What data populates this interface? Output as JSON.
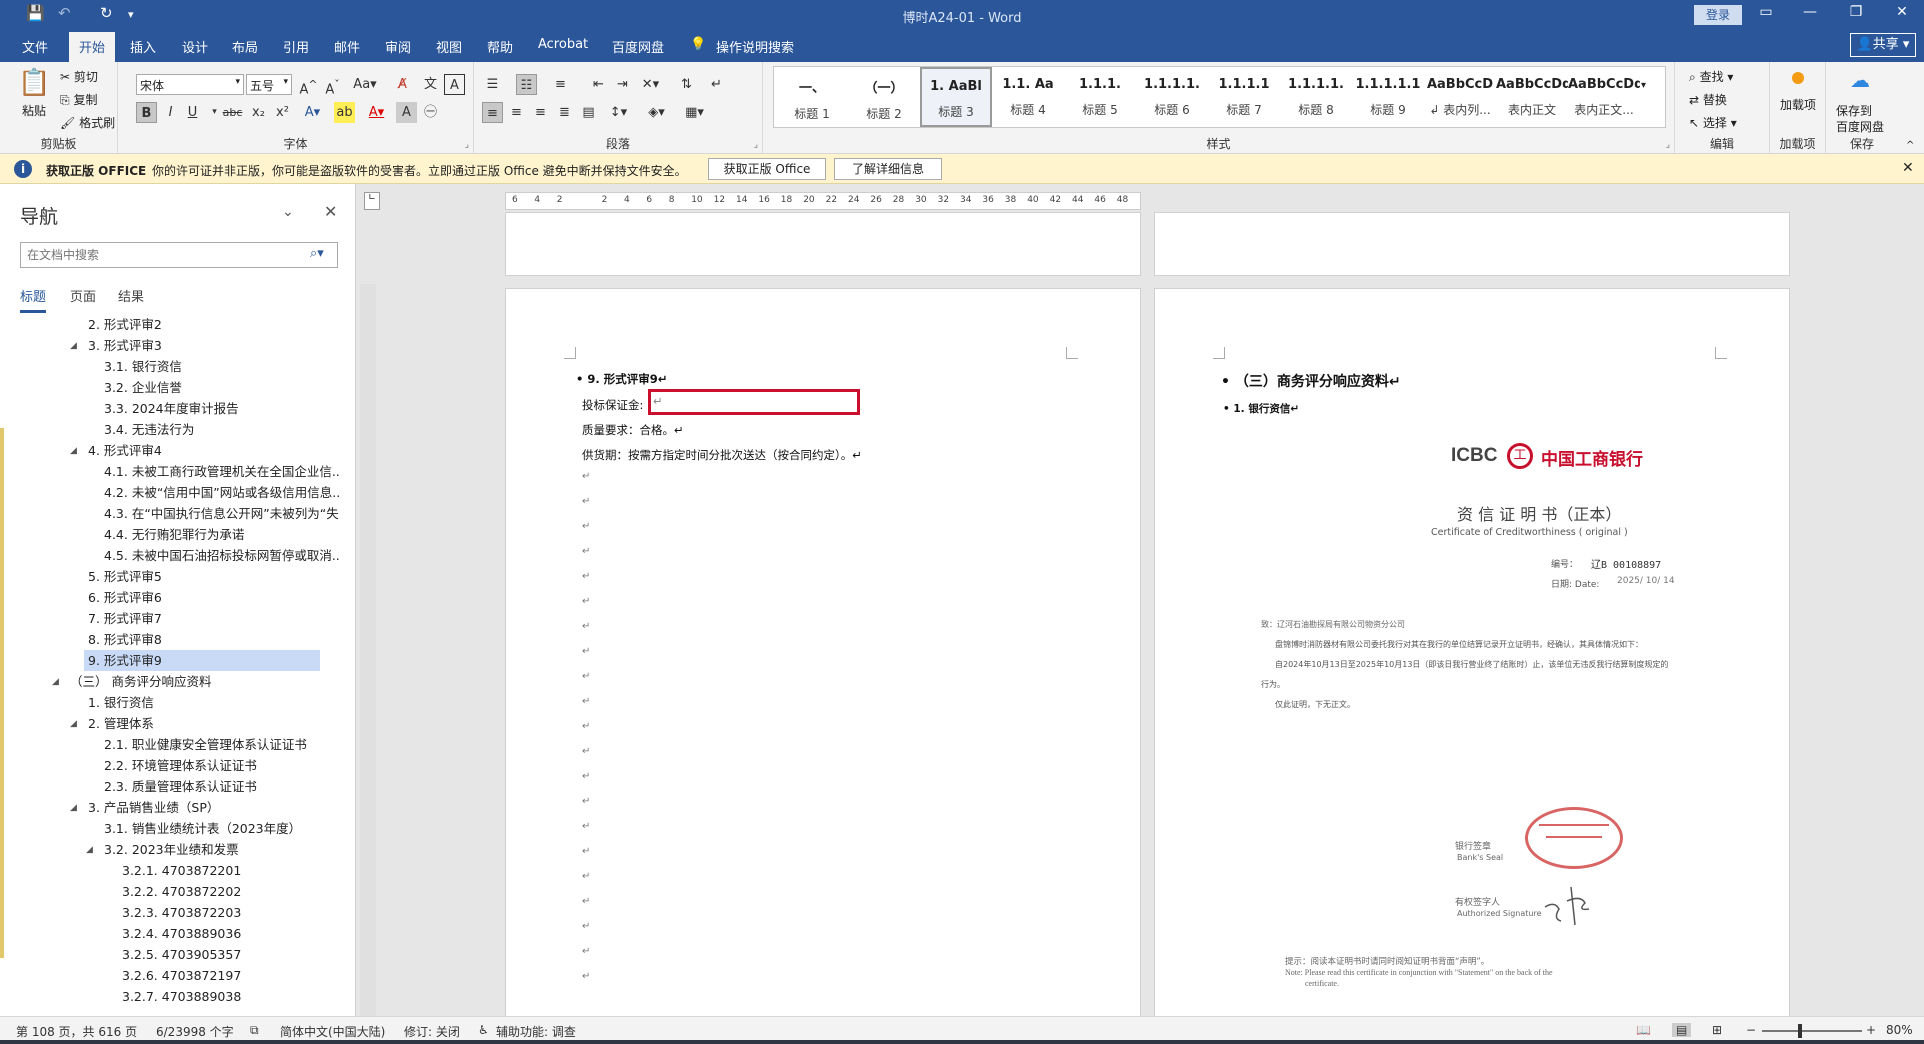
{
  "titlebar": {
    "doc_title": "博时A24-01  -  Word",
    "login_label": "登录"
  },
  "tabs": [
    "文件",
    "开始",
    "插入",
    "设计",
    "布局",
    "引用",
    "邮件",
    "审阅",
    "视图",
    "帮助",
    "Acrobat",
    "百度网盘"
  ],
  "tell_me": "操作说明搜索",
  "share_label": "共享",
  "ribbon": {
    "clipboard": {
      "paste": "粘贴",
      "cut": "剪切",
      "copy": "复制",
      "format_painter": "格式刷",
      "label": "剪贴板"
    },
    "font": {
      "name": "宋体",
      "size": "五号",
      "label": "字体"
    },
    "paragraph": {
      "label": "段落"
    },
    "styles": {
      "label": "样式",
      "items": [
        {
          "preview": "一、",
          "name": "标题 1"
        },
        {
          "preview": "（一）",
          "name": "标题 2"
        },
        {
          "preview": "1. AaBl",
          "name": "标题 3"
        },
        {
          "preview": "1.1. Aa",
          "name": "标题 4"
        },
        {
          "preview": "1.1.1.",
          "name": "标题 5"
        },
        {
          "preview": "1.1.1.1.",
          "name": "标题 6"
        },
        {
          "preview": "1.1.1.1",
          "name": "标题 7"
        },
        {
          "preview": "1.1.1.1.",
          "name": "标题 8"
        },
        {
          "preview": "1.1.1.1.1",
          "name": "标题 9"
        },
        {
          "preview": "AaBbCcD",
          "name": "↲ 表内列..."
        },
        {
          "preview": "AaBbCcDd",
          "name": "表内正文"
        },
        {
          "preview": "AaBbCcDd",
          "name": "表内正文..."
        }
      ]
    },
    "editing": {
      "find": "查找",
      "replace": "替换",
      "select": "选择",
      "label": "编辑"
    },
    "addins": {
      "btn": "加载项",
      "label": "加载项"
    },
    "save": {
      "btn1": "保存到",
      "btn2": "百度网盘",
      "label": "保存"
    }
  },
  "message_bar": {
    "title": "获取正版 OFFICE",
    "text": "你的许可证并非正版，你可能是盗版软件的受害者。立即通过正版 Office 避免中断并保持文件安全。",
    "btn_get": "获取正版 Office",
    "btn_more": "了解详细信息"
  },
  "nav": {
    "title": "导航",
    "search_placeholder": "在文档中搜索",
    "tabs": [
      "标题",
      "页面",
      "结果"
    ],
    "items": [
      {
        "text": "2. 形式评审2",
        "level": 1,
        "arrow": ""
      },
      {
        "text": "3. 形式评审3",
        "level": 1,
        "arrow": "◢"
      },
      {
        "text": "3.1. 银行资信",
        "level": 2,
        "arrow": ""
      },
      {
        "text": "3.2. 企业信誉",
        "level": 2,
        "arrow": ""
      },
      {
        "text": "3.3. 2024年度审计报告",
        "level": 2,
        "arrow": ""
      },
      {
        "text": "3.4. 无违法行为",
        "level": 2,
        "arrow": ""
      },
      {
        "text": "4. 形式评审4",
        "level": 1,
        "arrow": "◢"
      },
      {
        "text": "4.1. 未被工商行政管理机关在全国企业信...",
        "level": 2,
        "arrow": ""
      },
      {
        "text": "4.2. 未被“信用中国”网站或各级信用信息...",
        "level": 2,
        "arrow": ""
      },
      {
        "text": "4.3. 在“中国执行信息公开网”未被列为“失...",
        "level": 2,
        "arrow": ""
      },
      {
        "text": "4.4. 无行贿犯罪行为承诺",
        "level": 2,
        "arrow": ""
      },
      {
        "text": "4.5. 未被中国石油招标投标网暂停或取消...",
        "level": 2,
        "arrow": ""
      },
      {
        "text": "5. 形式评审5",
        "level": 1,
        "arrow": ""
      },
      {
        "text": "6. 形式评审6",
        "level": 1,
        "arrow": ""
      },
      {
        "text": "7. 形式评审7",
        "level": 1,
        "arrow": ""
      },
      {
        "text": "8. 形式评审8",
        "level": 1,
        "arrow": ""
      },
      {
        "text": "9. 形式评审9",
        "level": 1,
        "arrow": "",
        "selected": true
      },
      {
        "text": "（三） 商务评分响应资料",
        "level": 0,
        "arrow": "◢"
      },
      {
        "text": "1. 银行资信",
        "level": 1,
        "arrow": ""
      },
      {
        "text": "2. 管理体系",
        "level": 1,
        "arrow": "◢"
      },
      {
        "text": "2.1. 职业健康安全管理体系认证证书",
        "level": 2,
        "arrow": ""
      },
      {
        "text": "2.2. 环境管理体系认证证书",
        "level": 2,
        "arrow": ""
      },
      {
        "text": "2.3. 质量管理体系认证证书",
        "level": 2,
        "arrow": ""
      },
      {
        "text": "3. 产品销售业绩（SP）",
        "level": 1,
        "arrow": "◢"
      },
      {
        "text": "3.1. 销售业绩统计表（2023年度）",
        "level": 2,
        "arrow": ""
      },
      {
        "text": "3.2. 2023年业绩和发票",
        "level": 2,
        "arrow": "◢"
      },
      {
        "text": "3.2.1. 4703872201",
        "level": 3,
        "arrow": ""
      },
      {
        "text": "3.2.2. 4703872202",
        "level": 3,
        "arrow": ""
      },
      {
        "text": "3.2.3. 4703872203",
        "level": 3,
        "arrow": ""
      },
      {
        "text": "3.2.4. 4703889036",
        "level": 3,
        "arrow": ""
      },
      {
        "text": "3.2.5. 4703905357",
        "level": 3,
        "arrow": ""
      },
      {
        "text": "3.2.6. 4703872197",
        "level": 3,
        "arrow": ""
      },
      {
        "text": "3.2.7. 4703889038",
        "level": 3,
        "arrow": ""
      }
    ]
  },
  "ruler": {
    "ticks": [
      "6",
      "4",
      "2",
      "",
      "2",
      "4",
      "6",
      "8",
      "10",
      "12",
      "14",
      "16",
      "18",
      "20",
      "22",
      "24",
      "26",
      "28",
      "30",
      "32",
      "34",
      "36",
      "38",
      "40",
      "42",
      "44",
      "46",
      "48"
    ]
  },
  "page_left": {
    "heading": "• 9. 形式评审9↵",
    "line1_label": "投标保证金:",
    "line1_value": "↵",
    "line2": "质量要求：合格。↵",
    "line3": "供货期：按需方指定时间分批次送达（按合同约定）。↵",
    "para_mark": "↵"
  },
  "page_right": {
    "heading": "• （三）商务评分响应资料↵",
    "sub": "• 1. 银行资信↵",
    "cert": {
      "bank_en": "ICBC",
      "bank_cn": "中国工商银行",
      "title_cn": "资 信 证 明 书（正本）",
      "title_en": "Certificate of Creditworthiness ( original )",
      "no_label": "编号：",
      "no_value": "辽B 00108897",
      "date_label": "日期: Date:",
      "date_value": "2025/ 10/ 14",
      "to": "致：辽河石油勘探局有限公司物资分公司",
      "body1": "盘锦博时消防器材有限公司委托我行对其在我行的单位结算记录开立证明书，经确认，其具体情况如下：",
      "body2": "自2024年10月13日至2025年10月13日（即该日我行营业终了结账时）止，该单位无违反我行结算制度规定的",
      "body3": "行为。",
      "body4": "仅此证明，下无正文。",
      "seal_cn": "银行签章",
      "seal_en": "Bank's Seal",
      "sig_cn": "有权签字人",
      "sig_en": "Authorized Signature",
      "note_cn": "提示：阅读本证明书时请同时阅知证明书背面“声明”。",
      "note_en1": "Note: Please read this certificate in conjunction with \"Statement\" on the back of the",
      "note_en2": "certificate."
    }
  },
  "status": {
    "page": "第 108 页，共 616 页",
    "words": "6/23998 个字",
    "lang": "简体中文(中国大陆)",
    "track": "修订: 关闭",
    "access": "辅助功能: 调查",
    "zoom": "80%"
  }
}
